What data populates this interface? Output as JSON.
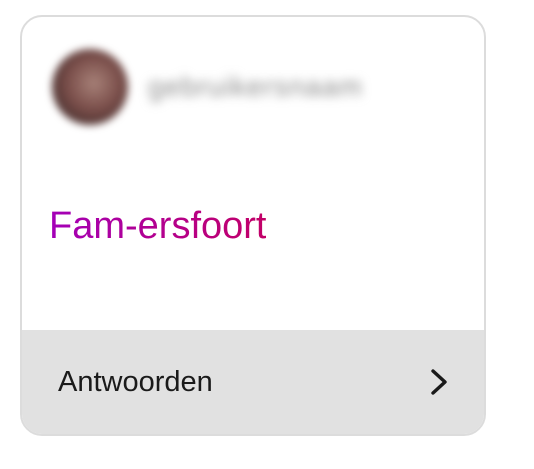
{
  "post": {
    "username": "gebruikersnaam",
    "message": "Fam-ersfoort"
  },
  "reply": {
    "label": "Antwoorden"
  },
  "icons": {
    "avatar": "profile-photo",
    "chevron": "chevron-right-icon"
  },
  "colors": {
    "message_gradient_start": "#a300b8",
    "message_gradient_end": "#c20067",
    "reply_bar": "#e1e1e1"
  }
}
